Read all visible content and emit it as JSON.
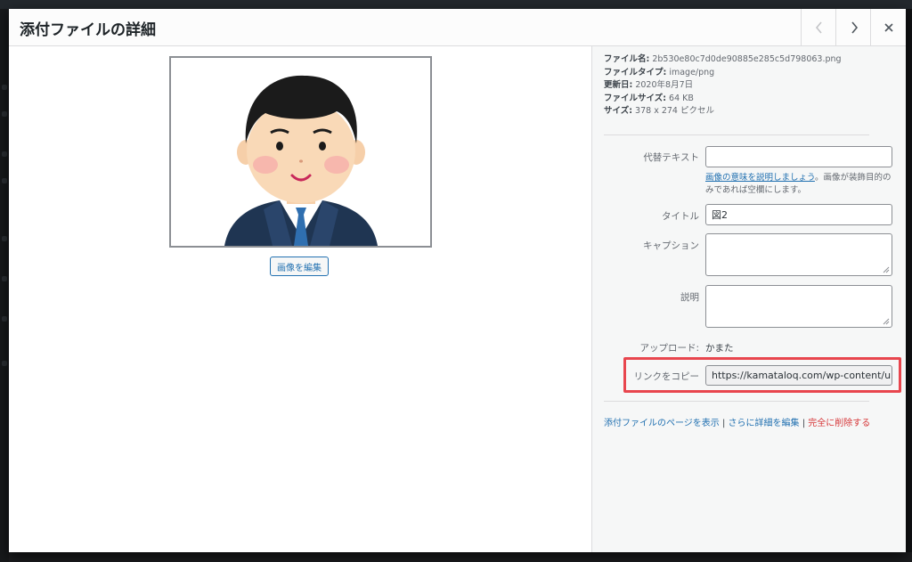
{
  "modal": {
    "title": "添付ファイルの詳細",
    "prev_icon": "chevron-left-icon",
    "next_icon": "chevron-right-icon",
    "close_icon": "close-icon"
  },
  "preview": {
    "edit_image_label": "画像を編集"
  },
  "file_meta": {
    "filename_label": "ファイル名:",
    "filename_value": "2b530e80c7d0de90885e285c5d798063.png",
    "filetype_label": "ファイルタイプ:",
    "filetype_value": "image/png",
    "uploaded_label": "更新日:",
    "uploaded_value": "2020年8月7日",
    "filesize_label": "ファイルサイズ:",
    "filesize_value": "64 KB",
    "dimensions_label": "サイズ:",
    "dimensions_value": "378 x 274 ピクセル"
  },
  "fields": {
    "alt_label": "代替テキスト",
    "alt_value": "",
    "alt_help_link": "画像の意味を説明しましょう",
    "alt_help_text": "。画像が装飾目的のみであれば空欄にします。",
    "title_label": "タイトル",
    "title_value": "図2",
    "caption_label": "キャプション",
    "caption_value": "",
    "description_label": "説明",
    "description_value": "",
    "uploaded_by_label": "アップロード:",
    "uploaded_by_value": "かまた",
    "copy_link_label": "リンクをコピー",
    "copy_link_value": "https://kamataloq.com/wp-content/uploa"
  },
  "actions": {
    "view_page": "添付ファイルのページを表示",
    "sep1": " | ",
    "edit_more": "さらに詳細を編集",
    "sep2": " | ",
    "delete": "完全に削除する"
  },
  "colors": {
    "accent": "#2271b1",
    "danger": "#d63638",
    "highlight": "#e8464e"
  }
}
